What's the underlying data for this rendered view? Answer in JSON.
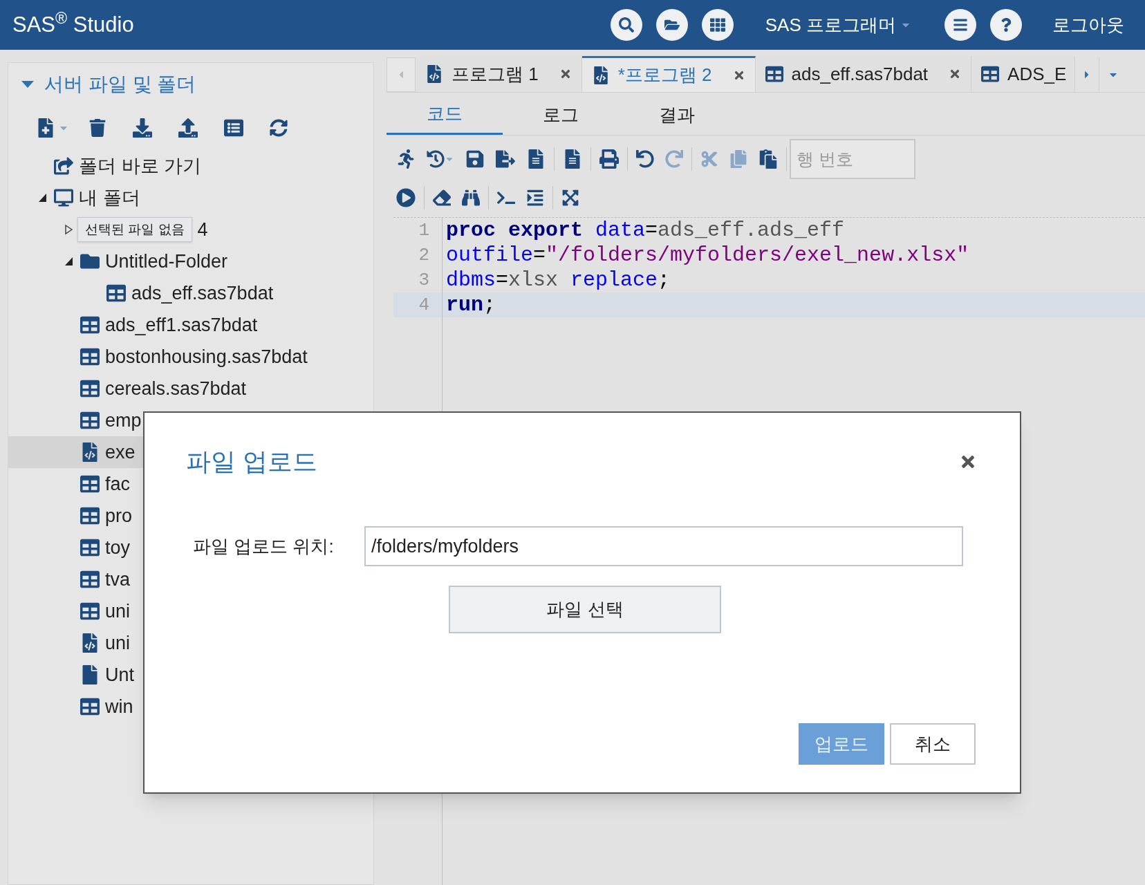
{
  "header": {
    "title": "SAS$^{®}$ Studio",
    "role": "SAS 프로그래머",
    "logout": "로그아웃"
  },
  "sidebar": {
    "title": "서버 파일 및 폴더",
    "expanded": true,
    "tooltip": "선택된 파일 없음",
    "tree": [
      {
        "label": "폴더 바로 가기",
        "kind": "shortcut",
        "selected": false
      },
      {
        "label": "내 폴더",
        "kind": "myfolder",
        "expanded": true,
        "selected": false,
        "children": [
          {
            "label": "4",
            "expanded": false,
            "selected": false
          },
          {
            "label": "Untitled-Folder",
            "kind": "folder",
            "expanded": true,
            "selected": false,
            "children": [
              {
                "label": "ads_eff.sas7bdat",
                "kind": "dataset",
                "selected": false
              }
            ]
          },
          {
            "label": "ads_eff1.sas7bdat",
            "kind": "dataset",
            "selected": false
          },
          {
            "label": "bostonhousing.sas7bdat",
            "kind": "dataset",
            "selected": false
          },
          {
            "label": "cereals.sas7bdat",
            "kind": "dataset",
            "selected": false
          },
          {
            "label": "emp",
            "kind": "dataset",
            "selected": false
          },
          {
            "label": "exe",
            "kind": "program",
            "selected": true
          },
          {
            "label": "fac",
            "kind": "dataset",
            "selected": false
          },
          {
            "label": "pro",
            "kind": "dataset",
            "selected": false
          },
          {
            "label": "toy",
            "kind": "dataset",
            "selected": false
          },
          {
            "label": "tva",
            "kind": "dataset",
            "selected": false
          },
          {
            "label": "uni",
            "kind": "dataset",
            "selected": false
          },
          {
            "label": "uni",
            "kind": "program",
            "selected": false
          },
          {
            "label": "Unt",
            "kind": "file",
            "selected": false
          },
          {
            "label": "win",
            "kind": "dataset",
            "selected": false
          }
        ]
      }
    ]
  },
  "tabs": [
    {
      "label": "프로그램 1",
      "kind": "program",
      "selected": false,
      "closable": true
    },
    {
      "label": "*프로그램 2",
      "kind": "program",
      "selected": true,
      "closable": true
    },
    {
      "label": "ads_eff.sas7bdat",
      "kind": "dataset",
      "selected": false,
      "closable": true
    },
    {
      "label": "ADS_E",
      "kind": "dataset",
      "selected": false,
      "closable": false
    }
  ],
  "subtabs": [
    {
      "label": "코드",
      "selected": true
    },
    {
      "label": "로그",
      "selected": false
    },
    {
      "label": "결과",
      "selected": false
    }
  ],
  "goto_line": {
    "placeholder": "행 번호"
  },
  "code": [
    {
      "number": "1",
      "current": false,
      "tokens": [
        {
          "kind": "keyword",
          "text": "proc "
        },
        {
          "kind": "keyword",
          "text": "export "
        },
        {
          "kind": "option",
          "text": "data"
        },
        {
          "kind": "punct",
          "text": "="
        },
        {
          "kind": "text",
          "text": "ads_eff.ads_eff"
        }
      ]
    },
    {
      "number": "2",
      "current": false,
      "tokens": [
        {
          "kind": "option",
          "text": "outfile"
        },
        {
          "kind": "punct",
          "text": "="
        },
        {
          "kind": "string",
          "text": "\"/folders/myfolders/exel_new.xlsx\""
        }
      ]
    },
    {
      "number": "3",
      "current": false,
      "tokens": [
        {
          "kind": "option",
          "text": "dbms"
        },
        {
          "kind": "punct",
          "text": "="
        },
        {
          "kind": "text",
          "text": "xlsx "
        },
        {
          "kind": "option",
          "text": "replace"
        },
        {
          "kind": "punct",
          "text": ";"
        }
      ]
    },
    {
      "number": "4",
      "current": true,
      "tokens": [
        {
          "kind": "keyword",
          "text": "run"
        },
        {
          "kind": "punct",
          "text": ";"
        }
      ]
    }
  ],
  "dialog": {
    "title": "파일 업로드",
    "location_label": "파일 업로드 위치:",
    "location_value": "/folders/myfolders",
    "choose_button": "파일 선택",
    "upload_button": {
      "label": "업로드",
      "disabled": true
    },
    "cancel_button": "취소"
  }
}
